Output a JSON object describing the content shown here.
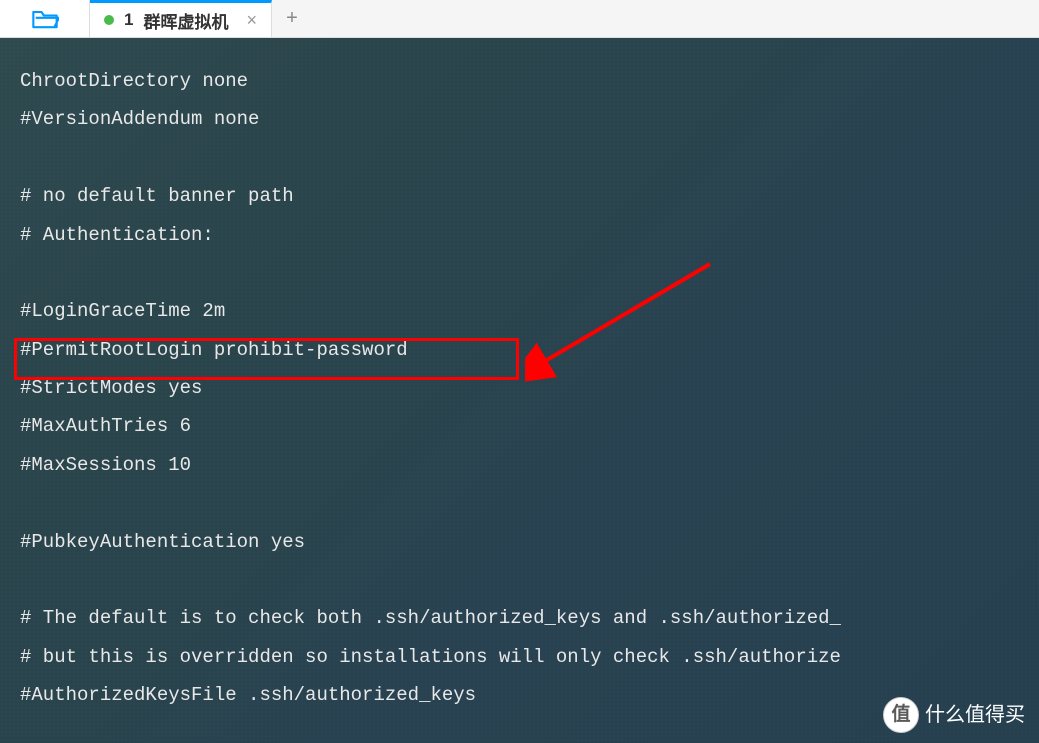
{
  "tabbar": {
    "tab_number": "1",
    "tab_title": "群晖虚拟机",
    "close_label": "×",
    "new_tab_label": "+"
  },
  "editor": {
    "lines": [
      "ChrootDirectory none",
      "#VersionAddendum none",
      "",
      "# no default banner path",
      "# Authentication:",
      "",
      "#LoginGraceTime 2m",
      "#PermitRootLogin prohibit-password",
      "#StrictModes yes",
      "#MaxAuthTries 6",
      "#MaxSessions 10",
      "",
      "#PubkeyAuthentication yes",
      "",
      "# The default is to check both .ssh/authorized_keys and .ssh/authorized_",
      "# but this is overridden so installations will only check .ssh/authorize",
      "#AuthorizedKeysFile .ssh/authorized_keys"
    ]
  },
  "watermark": {
    "badge": "值",
    "text": "什么值得买"
  },
  "annotation": {
    "highlight_color": "#ff0000",
    "arrow_color": "#ff0000"
  }
}
